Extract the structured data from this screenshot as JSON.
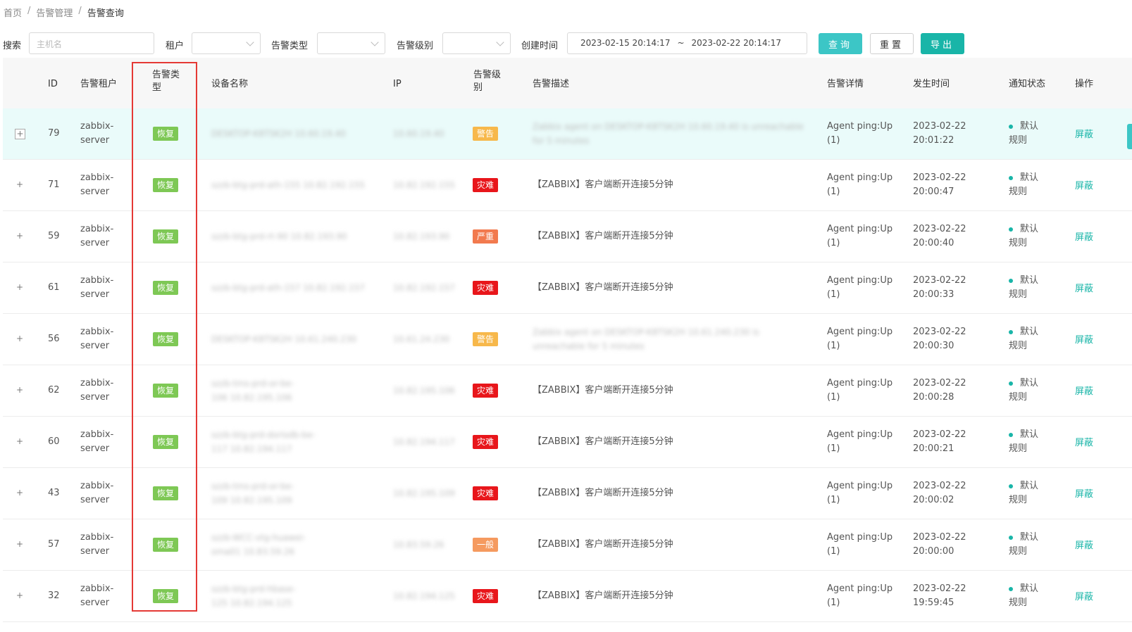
{
  "breadcrumb": [
    "首页",
    "告警管理",
    "告警查询"
  ],
  "breadcrumb_sep": "/",
  "filters": {
    "search_label": "搜索",
    "search_placeholder": "主机名",
    "tenant_label": "租户",
    "type_label": "告警类型",
    "level_label": "告警级别",
    "created_label": "创建时间",
    "date_start": "2023-02-15 20:14:17",
    "date_sep": "~",
    "date_end": "2023-02-22 20:14:17",
    "query_button": "查询",
    "reset_button": "重置",
    "export_button": "导出"
  },
  "columns": {
    "id": "ID",
    "tenant": "告警租户",
    "type_line1": "告警类",
    "type_line2": "型",
    "device": "设备名称",
    "ip": "IP",
    "level_line1": "告警级",
    "level_line2": "别",
    "desc": "告警描述",
    "detail": "告警详情",
    "time": "发生时间",
    "notify": "通知状态",
    "action": "操作"
  },
  "colors": {
    "recover": "#7ec855",
    "warning": "#f7b84b",
    "disaster": "#e8161b",
    "severe": "#f27a4e",
    "general": "#f59a5f",
    "accent": "#19b5a8",
    "highlight_box": "#e53935"
  },
  "rows": [
    {
      "expand": "+",
      "id": "79",
      "tenant1": "zabbix-",
      "tenant2": "server",
      "type": "恢复",
      "device1": "DESKTOP-K8TSK2H 10.60.19.40",
      "device2": "",
      "ip": "10.60.19.40",
      "level": "警告",
      "level_color": "#f7b84b",
      "desc1": "Zabbix agent on DESKTOP-K8TSK2H 10.60.19.40 is unreachable",
      "desc2": "for 5 minutes",
      "desc_blur": true,
      "detail1": "Agent ping:Up",
      "detail2": "(1)",
      "date": "2023-02-22",
      "time": "20:01:22",
      "notify1": "默认",
      "notify2": "规则",
      "action": "屏蔽"
    },
    {
      "expand": "+",
      "id": "71",
      "tenant1": "zabbix-",
      "tenant2": "server",
      "type": "恢复",
      "device1": "szzb-btg-prd-ath-155 10.82.192.155",
      "device2": "",
      "ip": "10.82.192.155",
      "level": "灾难",
      "level_color": "#e8161b",
      "desc1": "【ZABBIX】客户端断开连接5分钟",
      "desc2": "",
      "desc_blur": false,
      "detail1": "Agent ping:Up",
      "detail2": "(1)",
      "date": "2023-02-22",
      "time": "20:00:47",
      "notify1": "默认",
      "notify2": "规则",
      "action": "屏蔽"
    },
    {
      "expand": "+",
      "id": "59",
      "tenant1": "zabbix-",
      "tenant2": "server",
      "type": "恢复",
      "device1": "szzb-btg-prd-rt-90 10.82.193.90",
      "device2": "",
      "ip": "10.82.193.90",
      "level": "严重",
      "level_color": "#f27a4e",
      "desc1": "【ZABBIX】客户端断开连接5分钟",
      "desc2": "",
      "desc_blur": false,
      "detail1": "Agent ping:Up",
      "detail2": "(1)",
      "date": "2023-02-22",
      "time": "20:00:40",
      "notify1": "默认",
      "notify2": "规则",
      "action": "屏蔽"
    },
    {
      "expand": "+",
      "id": "61",
      "tenant1": "zabbix-",
      "tenant2": "server",
      "type": "恢复",
      "device1": "szzb-btg-prd-ath-157 10.82.192.157",
      "device2": "",
      "ip": "10.82.192.157",
      "level": "灾难",
      "level_color": "#e8161b",
      "desc1": "【ZABBIX】客户端断开连接5分钟",
      "desc2": "",
      "desc_blur": false,
      "detail1": "Agent ping:Up",
      "detail2": "(1)",
      "date": "2023-02-22",
      "time": "20:00:33",
      "notify1": "默认",
      "notify2": "规则",
      "action": "屏蔽"
    },
    {
      "expand": "+",
      "id": "56",
      "tenant1": "zabbix-",
      "tenant2": "server",
      "type": "恢复",
      "device1": "DESKTOP-K8TSK2H 10.61.240.230",
      "device2": "",
      "ip": "10.61.24.230",
      "level": "警告",
      "level_color": "#f7b84b",
      "desc1": "Zabbix agent on DESKTOP-K8TSK2H 10.61.240.230 is",
      "desc2": "unreachable for 5 minutes",
      "desc_blur": true,
      "detail1": "Agent ping:Up",
      "detail2": "(1)",
      "date": "2023-02-22",
      "time": "20:00:30",
      "notify1": "默认",
      "notify2": "规则",
      "action": "屏蔽"
    },
    {
      "expand": "+",
      "id": "62",
      "tenant1": "zabbix-",
      "tenant2": "server",
      "type": "恢复",
      "device1": "szzb-tms-prd-or-be-",
      "device2": "106 10.82.195.106",
      "ip": "10.82.195.106",
      "level": "灾难",
      "level_color": "#e8161b",
      "desc1": "【ZABBIX】客户端断开连接5分钟",
      "desc2": "",
      "desc_blur": false,
      "detail1": "Agent ping:Up",
      "detail2": "(1)",
      "date": "2023-02-22",
      "time": "20:00:28",
      "notify1": "默认",
      "notify2": "规则",
      "action": "屏蔽"
    },
    {
      "expand": "+",
      "id": "60",
      "tenant1": "zabbix-",
      "tenant2": "server",
      "type": "恢复",
      "device1": "szzb-btg-prd-dorisdb-be-",
      "device2": "117 10.82.194.117",
      "ip": "10.82.194.117",
      "level": "灾难",
      "level_color": "#e8161b",
      "desc1": "【ZABBIX】客户端断开连接5分钟",
      "desc2": "",
      "desc_blur": false,
      "detail1": "Agent ping:Up",
      "detail2": "(1)",
      "date": "2023-02-22",
      "time": "20:00:21",
      "notify1": "默认",
      "notify2": "规则",
      "action": "屏蔽"
    },
    {
      "expand": "+",
      "id": "43",
      "tenant1": "zabbix-",
      "tenant2": "server",
      "type": "恢复",
      "device1": "szzb-tms-prd-or-be-",
      "device2": "109 10.82.195.109",
      "ip": "10.82.195.109",
      "level": "灾难",
      "level_color": "#e8161b",
      "desc1": "【ZABBIX】客户端断开连接5分钟",
      "desc2": "",
      "desc_blur": false,
      "detail1": "Agent ping:Up",
      "detail2": "(1)",
      "date": "2023-02-22",
      "time": "20:00:02",
      "notify1": "默认",
      "notify2": "规则",
      "action": "屏蔽"
    },
    {
      "expand": "+",
      "id": "57",
      "tenant1": "zabbix-",
      "tenant2": "server",
      "type": "恢复",
      "device1": "szzb-WCC-vtg-huawei-",
      "device2": "oma01 10.83.59.26",
      "ip": "10.83.59.26",
      "level": "一般",
      "level_color": "#f59a5f",
      "desc1": "【ZABBIX】客户端断开连接5分钟",
      "desc2": "",
      "desc_blur": false,
      "detail1": "Agent ping:Up",
      "detail2": "(1)",
      "date": "2023-02-22",
      "time": "20:00:00",
      "notify1": "默认",
      "notify2": "规则",
      "action": "屏蔽"
    },
    {
      "expand": "+",
      "id": "32",
      "tenant1": "zabbix-",
      "tenant2": "server",
      "type": "恢复",
      "device1": "szzb-btg-prd-hbase-",
      "device2": "125 10.82.194.125",
      "ip": "10.82.194.125",
      "level": "灾难",
      "level_color": "#e8161b",
      "desc1": "【ZABBIX】客户端断开连接5分钟",
      "desc2": "",
      "desc_blur": false,
      "detail1": "Agent ping:Up",
      "detail2": "(1)",
      "date": "2023-02-22",
      "time": "19:59:45",
      "notify1": "默认",
      "notify2": "规则",
      "action": "屏蔽"
    }
  ]
}
